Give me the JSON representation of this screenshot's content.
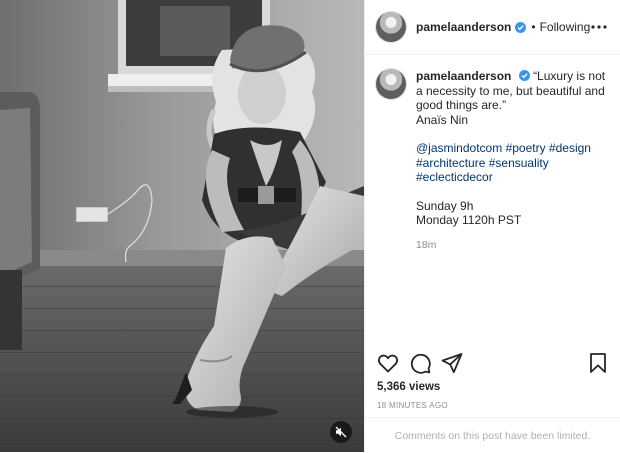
{
  "post": {
    "username": "pamelaanderson",
    "follow_label": "Following",
    "separator": "•",
    "caption": {
      "quote_line": "“Luxury is not a necessity to me, but beautiful and good things are.”",
      "author": "Anaïs Nin",
      "mention": "@jasmindotcom",
      "tags": [
        "#poetry",
        "#design",
        "#architecture",
        "#sensuality",
        "#eclecticdecor"
      ],
      "schedule_day": "Sunday 9h",
      "schedule_time": "Monday 1120h PST"
    },
    "comment_age": "18m",
    "views": "5,366 views",
    "posted_ago": "18 MINUTES AGO",
    "comments_notice": "Comments on this post have been limited."
  },
  "icons": {
    "verified": "verified-badge-icon",
    "more": "more-options-icon",
    "like": "heart-icon",
    "comment": "comment-icon",
    "share": "share-icon",
    "save": "bookmark-icon",
    "mute": "speaker-muted-icon"
  },
  "colors": {
    "verified_blue": "#3897f0",
    "link": "#00376b",
    "muted_text": "#8e8e8e"
  }
}
